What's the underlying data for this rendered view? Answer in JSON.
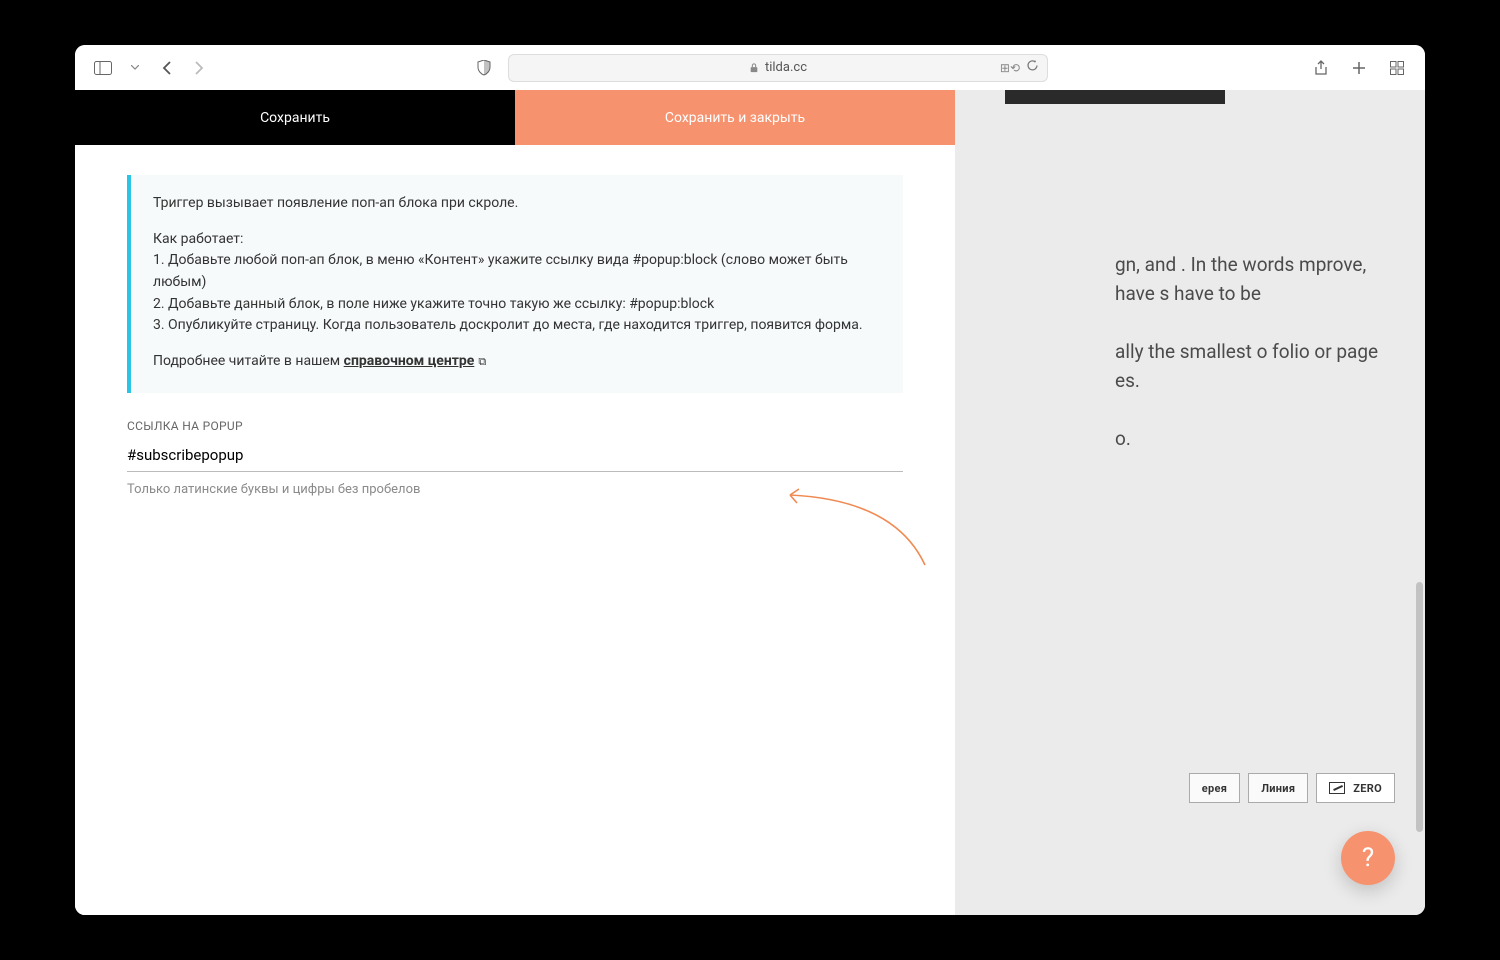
{
  "browser": {
    "url": "tilda.cc"
  },
  "panel": {
    "save": "Сохранить",
    "saveClose": "Сохранить и закрыть"
  },
  "info": {
    "intro": "Триггер вызывает появление поп-ап блока при скроле.",
    "howLabel": "Как работает:",
    "step1": "1. Добавьте любой поп-ап блок, в меню «Контент» укажите ссылку вида #popup:block (слово может быть любым)",
    "step2": "2. Добавьте данный блок, в поле ниже укажите точно такую же ссылку: #popup:block",
    "step3": "3. Опубликуйте страницу. Когда пользователь доскролит до места, где находится триггер, появится форма.",
    "readMore": "Подробнее читайте в нашем ",
    "helpLink": "справочном центре"
  },
  "field": {
    "label": "ССЫЛКА НА POPUP",
    "value": "#subscribepopup",
    "hint": "Только латинские буквы и цифры без пробелов"
  },
  "preview": {
    "p1": "gn, and . In the words mprove, have s have to be",
    "p2": "ally the smallest o folio or page es.",
    "p3": "o."
  },
  "blocks": {
    "gallery": "ерея",
    "line": "Линия",
    "zero": "ZERO"
  },
  "fab": "?"
}
